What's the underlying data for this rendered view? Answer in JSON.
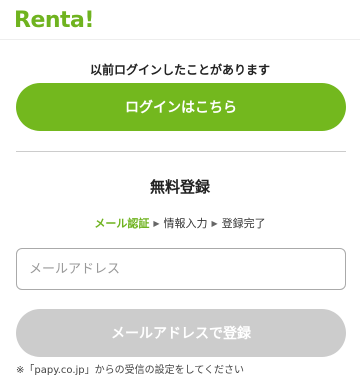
{
  "header": {
    "logo_text": "Renta!"
  },
  "login": {
    "previous_message": "以前ログインしたことがあります",
    "button_label": "ログインはこちら"
  },
  "registration": {
    "title": "無料登録",
    "steps": [
      "メール認証",
      "情報入力",
      "登録完了"
    ],
    "email_placeholder": "メールアドレス",
    "submit_label": "メールアドレスで登録",
    "note": "※「papy.co.jp」からの受信の設定をしてください"
  },
  "colors": {
    "brand_green": "#73b81e",
    "disabled_gray": "#cccccc"
  }
}
